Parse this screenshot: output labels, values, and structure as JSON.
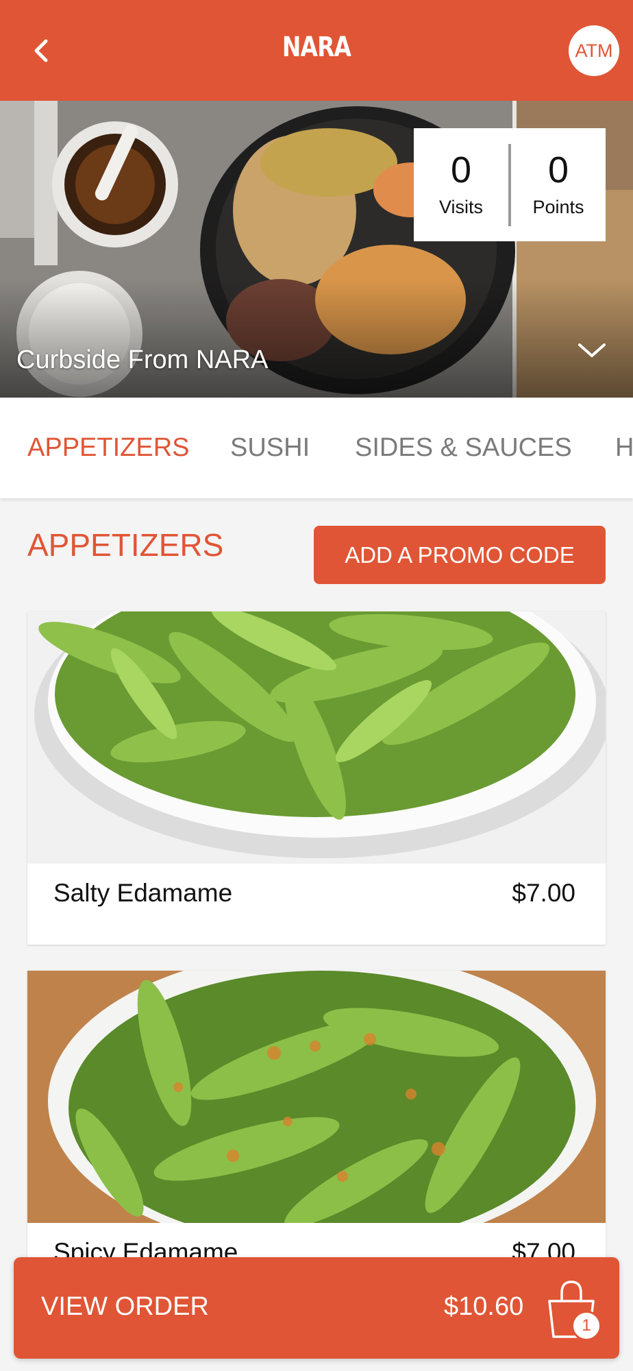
{
  "header": {
    "title": "NARA",
    "avatar_initials": "ATM"
  },
  "hero": {
    "location_label": "Curbside From NARA",
    "stats": [
      {
        "value": "0",
        "label": "Visits"
      },
      {
        "value": "0",
        "label": "Points"
      }
    ]
  },
  "tabs": [
    {
      "label": "APPETIZERS",
      "active": true
    },
    {
      "label": "SUSHI",
      "active": false
    },
    {
      "label": "SIDES & SAUCES",
      "active": false
    },
    {
      "label": "H",
      "active": false
    }
  ],
  "section": {
    "title": "APPETIZERS",
    "promo_label": "ADD A PROMO CODE"
  },
  "menu_items": [
    {
      "name": "Salty Edamame",
      "price": "$7.00"
    },
    {
      "name": "Spicy Edamame",
      "price": "$7.00"
    }
  ],
  "order_bar": {
    "label": "VIEW ORDER",
    "total": "$10.60",
    "item_count": "1"
  },
  "colors": {
    "brand": "#e05535",
    "white": "#ffffff"
  },
  "icons": [
    "chevron-left-icon",
    "chevron-down-icon",
    "shopping-bag-icon"
  ]
}
